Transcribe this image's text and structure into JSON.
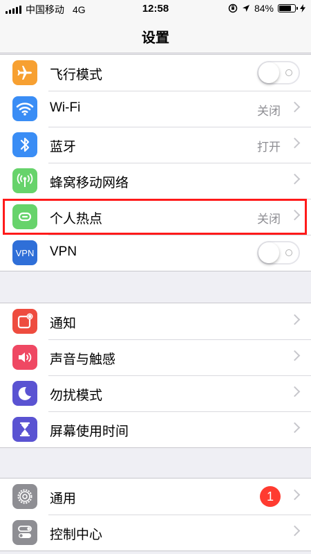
{
  "status_bar": {
    "carrier": "中国移动",
    "network": "4G",
    "time": "12:58",
    "battery": "84%",
    "battery_level": 0.84
  },
  "nav": {
    "title": "设置"
  },
  "group1": [
    {
      "label": "飞行模式",
      "icon": "airplane-icon",
      "color": "#f7a031",
      "control": "toggle",
      "on": false
    },
    {
      "label": "Wi-Fi",
      "icon": "wifi-icon",
      "color": "#3a8df5",
      "value": "关闭"
    },
    {
      "label": "蓝牙",
      "icon": "bluetooth-icon",
      "color": "#3a8df5",
      "value": "打开"
    },
    {
      "label": "蜂窝移动网络",
      "icon": "antenna-icon",
      "color": "#67d36b"
    },
    {
      "label": "个人热点",
      "icon": "hotspot-icon",
      "color": "#67d36b",
      "value": "关闭"
    },
    {
      "label": "VPN",
      "icon": "vpn-icon",
      "icon_text": "VPN",
      "color": "#2f6fd8",
      "control": "toggle",
      "on": false
    }
  ],
  "group2": [
    {
      "label": "通知",
      "icon": "notifications-icon",
      "color": "#ee4c3f"
    },
    {
      "label": "声音与触感",
      "icon": "speaker-icon",
      "color": "#ef4863"
    },
    {
      "label": "勿扰模式",
      "icon": "moon-icon",
      "color": "#5a53d2"
    },
    {
      "label": "屏幕使用时间",
      "icon": "hourglass-icon",
      "color": "#5a53d2"
    }
  ],
  "group3": [
    {
      "label": "通用",
      "icon": "gear-icon",
      "color": "#8e8e93",
      "badge": "1"
    },
    {
      "label": "控制中心",
      "icon": "control-center-icon",
      "color": "#8e8e93"
    }
  ],
  "highlight_color": "#ff1a1a"
}
